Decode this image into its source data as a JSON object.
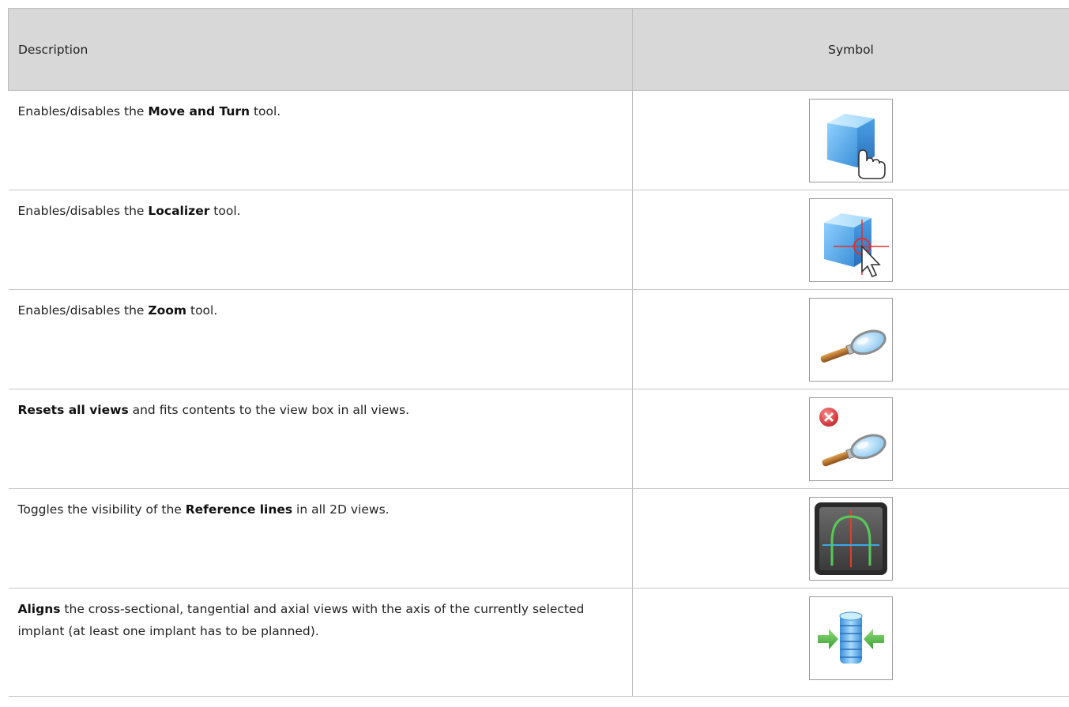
{
  "table": {
    "header_description": "Description",
    "header_symbol": "Symbol",
    "rows": [
      {
        "pre": "Enables/disables the ",
        "bold": "Move and Turn",
        "post": " tool.",
        "icon": "move-turn-icon"
      },
      {
        "pre": "Enables/disables the ",
        "bold": "Localizer",
        "post": " tool.",
        "icon": "localizer-icon"
      },
      {
        "pre": "Enables/disables the ",
        "bold": "Zoom",
        "post": " tool.",
        "icon": "zoom-icon"
      },
      {
        "pre": "",
        "bold": "Resets all views",
        "post": " and fits contents to the view box in all views.",
        "icon": "reset-views-icon"
      },
      {
        "pre": "Toggles the visibility of the ",
        "bold": "Reference lines",
        "post": " in all 2D views.",
        "icon": "reference-lines-icon"
      },
      {
        "pre": "",
        "bold": "Aligns",
        "post": " the cross-sectional, tangential and axial views with the axis of the currently selected implant (at least one implant has to be planned).",
        "icon": "align-implant-icon"
      }
    ]
  },
  "colors": {
    "header_bg": "#d8d8d8",
    "cube_blue": "#5aa8e8",
    "crosshair_red": "#e0302a",
    "reset_red": "#d9353a",
    "arrow_green": "#58b848"
  }
}
